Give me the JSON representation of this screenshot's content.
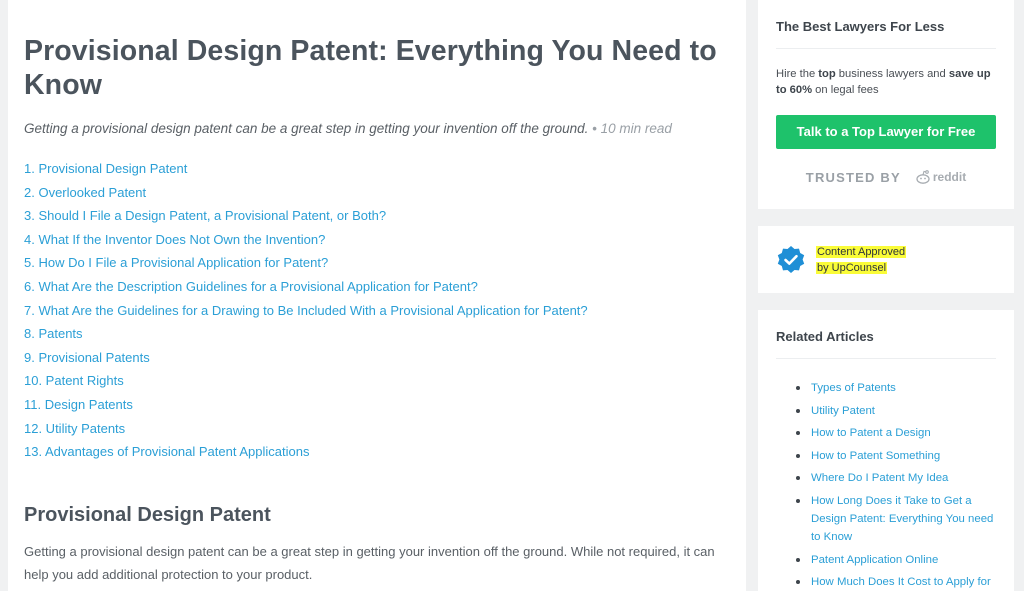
{
  "article": {
    "title": "Provisional Design Patent: Everything You Need to Know",
    "subtitle": "Getting a provisional design patent can be a great step in getting your invention off the ground.",
    "read_time": " • 10 min read",
    "toc": [
      "1. Provisional Design Patent",
      "2. Overlooked Patent",
      "3. Should I File a Design Patent, a Provisional Patent, or Both?",
      "4. What If the Inventor Does Not Own the Invention?",
      "5. How Do I File a Provisional Application for Patent?",
      "6. What Are the Description Guidelines for a Provisional Application for Patent?",
      "7. What Are the Guidelines for a Drawing to Be Included With a Provisional Application for Patent?",
      "8. Patents",
      "9. Provisional Patents",
      "10. Patent Rights",
      "11. Design Patents",
      "12. Utility Patents",
      "13. Advantages of Provisional Patent Applications"
    ],
    "section_heading": "Provisional Design Patent",
    "section_body": "Getting a provisional design patent can be a great step in getting your invention off the ground. While not required, it can help you add additional protection to your product."
  },
  "sidebar": {
    "lawyers_card": {
      "heading": "The Best Lawyers For Less",
      "text_pre": "Hire the ",
      "text_bold1": "top",
      "text_mid": " business lawyers and ",
      "text_bold2": "save up to 60%",
      "text_post": " on legal fees",
      "cta_label": "Talk to a Top Lawyer for Free",
      "trusted_label": "TRUSTED BY",
      "trusted_logo": "reddit"
    },
    "approved_card": {
      "line1": "Content Approved",
      "line2": "by UpCounsel",
      "badge_icon": "check-badge-icon",
      "badge_color": "#1f8fd6"
    },
    "related_card": {
      "heading": "Related Articles",
      "items": [
        "Types of Patents",
        "Utility Patent",
        "How to Patent a Design",
        "How to Patent Something",
        "Where Do I Patent My Idea",
        "How Long Does it Take to Get a Design Patent: Everything You need to Know",
        "Patent Application Online",
        "How Much Does It Cost to Apply for"
      ]
    }
  },
  "colors": {
    "link": "#2b9fd6",
    "cta": "#1ec26b",
    "highlight": "#fafc38",
    "background": "#f0f1f2"
  }
}
